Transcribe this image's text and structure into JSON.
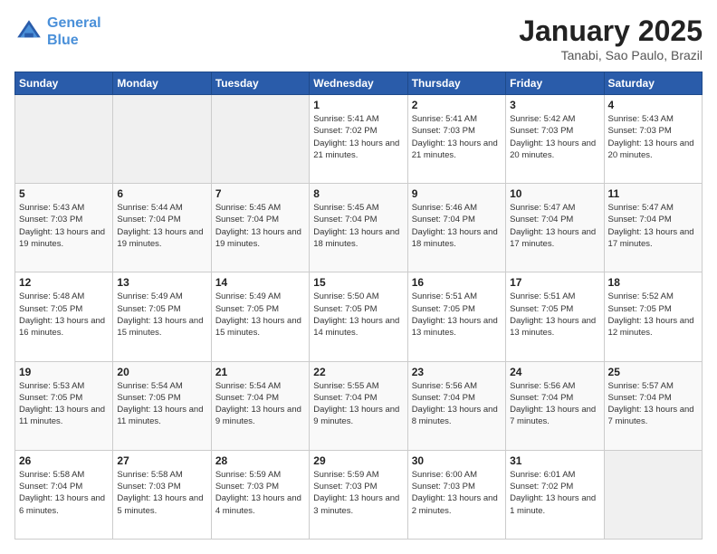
{
  "header": {
    "logo_line1": "General",
    "logo_line2": "Blue",
    "title": "January 2025",
    "subtitle": "Tanabi, Sao Paulo, Brazil"
  },
  "weekdays": [
    "Sunday",
    "Monday",
    "Tuesday",
    "Wednesday",
    "Thursday",
    "Friday",
    "Saturday"
  ],
  "weeks": [
    [
      {
        "day": "",
        "info": ""
      },
      {
        "day": "",
        "info": ""
      },
      {
        "day": "",
        "info": ""
      },
      {
        "day": "1",
        "info": "Sunrise: 5:41 AM\nSunset: 7:02 PM\nDaylight: 13 hours and 21 minutes."
      },
      {
        "day": "2",
        "info": "Sunrise: 5:41 AM\nSunset: 7:03 PM\nDaylight: 13 hours and 21 minutes."
      },
      {
        "day": "3",
        "info": "Sunrise: 5:42 AM\nSunset: 7:03 PM\nDaylight: 13 hours and 20 minutes."
      },
      {
        "day": "4",
        "info": "Sunrise: 5:43 AM\nSunset: 7:03 PM\nDaylight: 13 hours and 20 minutes."
      }
    ],
    [
      {
        "day": "5",
        "info": "Sunrise: 5:43 AM\nSunset: 7:03 PM\nDaylight: 13 hours and 19 minutes."
      },
      {
        "day": "6",
        "info": "Sunrise: 5:44 AM\nSunset: 7:04 PM\nDaylight: 13 hours and 19 minutes."
      },
      {
        "day": "7",
        "info": "Sunrise: 5:45 AM\nSunset: 7:04 PM\nDaylight: 13 hours and 19 minutes."
      },
      {
        "day": "8",
        "info": "Sunrise: 5:45 AM\nSunset: 7:04 PM\nDaylight: 13 hours and 18 minutes."
      },
      {
        "day": "9",
        "info": "Sunrise: 5:46 AM\nSunset: 7:04 PM\nDaylight: 13 hours and 18 minutes."
      },
      {
        "day": "10",
        "info": "Sunrise: 5:47 AM\nSunset: 7:04 PM\nDaylight: 13 hours and 17 minutes."
      },
      {
        "day": "11",
        "info": "Sunrise: 5:47 AM\nSunset: 7:04 PM\nDaylight: 13 hours and 17 minutes."
      }
    ],
    [
      {
        "day": "12",
        "info": "Sunrise: 5:48 AM\nSunset: 7:05 PM\nDaylight: 13 hours and 16 minutes."
      },
      {
        "day": "13",
        "info": "Sunrise: 5:49 AM\nSunset: 7:05 PM\nDaylight: 13 hours and 15 minutes."
      },
      {
        "day": "14",
        "info": "Sunrise: 5:49 AM\nSunset: 7:05 PM\nDaylight: 13 hours and 15 minutes."
      },
      {
        "day": "15",
        "info": "Sunrise: 5:50 AM\nSunset: 7:05 PM\nDaylight: 13 hours and 14 minutes."
      },
      {
        "day": "16",
        "info": "Sunrise: 5:51 AM\nSunset: 7:05 PM\nDaylight: 13 hours and 13 minutes."
      },
      {
        "day": "17",
        "info": "Sunrise: 5:51 AM\nSunset: 7:05 PM\nDaylight: 13 hours and 13 minutes."
      },
      {
        "day": "18",
        "info": "Sunrise: 5:52 AM\nSunset: 7:05 PM\nDaylight: 13 hours and 12 minutes."
      }
    ],
    [
      {
        "day": "19",
        "info": "Sunrise: 5:53 AM\nSunset: 7:05 PM\nDaylight: 13 hours and 11 minutes."
      },
      {
        "day": "20",
        "info": "Sunrise: 5:54 AM\nSunset: 7:05 PM\nDaylight: 13 hours and 11 minutes."
      },
      {
        "day": "21",
        "info": "Sunrise: 5:54 AM\nSunset: 7:04 PM\nDaylight: 13 hours and 9 minutes."
      },
      {
        "day": "22",
        "info": "Sunrise: 5:55 AM\nSunset: 7:04 PM\nDaylight: 13 hours and 9 minutes."
      },
      {
        "day": "23",
        "info": "Sunrise: 5:56 AM\nSunset: 7:04 PM\nDaylight: 13 hours and 8 minutes."
      },
      {
        "day": "24",
        "info": "Sunrise: 5:56 AM\nSunset: 7:04 PM\nDaylight: 13 hours and 7 minutes."
      },
      {
        "day": "25",
        "info": "Sunrise: 5:57 AM\nSunset: 7:04 PM\nDaylight: 13 hours and 7 minutes."
      }
    ],
    [
      {
        "day": "26",
        "info": "Sunrise: 5:58 AM\nSunset: 7:04 PM\nDaylight: 13 hours and 6 minutes."
      },
      {
        "day": "27",
        "info": "Sunrise: 5:58 AM\nSunset: 7:03 PM\nDaylight: 13 hours and 5 minutes."
      },
      {
        "day": "28",
        "info": "Sunrise: 5:59 AM\nSunset: 7:03 PM\nDaylight: 13 hours and 4 minutes."
      },
      {
        "day": "29",
        "info": "Sunrise: 5:59 AM\nSunset: 7:03 PM\nDaylight: 13 hours and 3 minutes."
      },
      {
        "day": "30",
        "info": "Sunrise: 6:00 AM\nSunset: 7:03 PM\nDaylight: 13 hours and 2 minutes."
      },
      {
        "day": "31",
        "info": "Sunrise: 6:01 AM\nSunset: 7:02 PM\nDaylight: 13 hours and 1 minute."
      },
      {
        "day": "",
        "info": ""
      }
    ]
  ]
}
